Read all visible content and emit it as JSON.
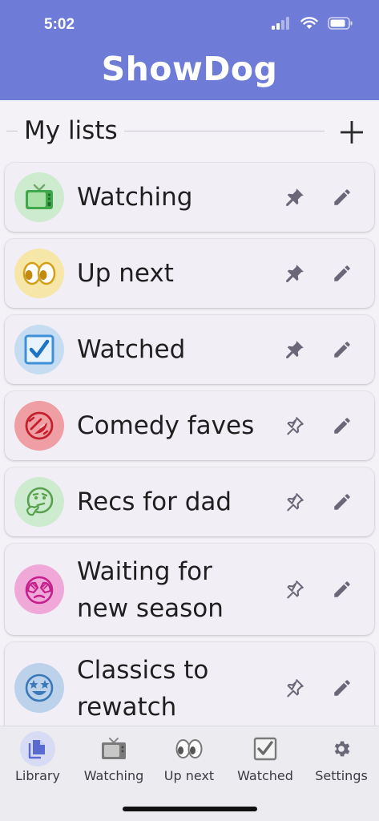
{
  "status_bar": {
    "time": "5:02"
  },
  "app": {
    "title": "ShowDog"
  },
  "section": {
    "title": "My lists",
    "add_glyph": "+"
  },
  "lists": [
    {
      "label": "Watching",
      "icon": "television-icon",
      "color": "#cdeccf",
      "pinned": true
    },
    {
      "label": "Up next",
      "icon": "eyes-icon",
      "color": "#f6e7a8",
      "pinned": true
    },
    {
      "label": "Watched",
      "icon": "checkbox-icon",
      "color": "#c6ddf1",
      "pinned": true
    },
    {
      "label": "Comedy faves",
      "icon": "rolling-laughing-icon",
      "color": "#ef9ea3",
      "pinned": false
    },
    {
      "label": "Recs for dad",
      "icon": "thinking-face-icon",
      "color": "#cdeccf",
      "pinned": false
    },
    {
      "label": "Waiting for new season",
      "icon": "see-no-evil-icon",
      "color": "#f0a8d8",
      "pinned": false
    },
    {
      "label": "Classics to rewatch",
      "icon": "star-struck-icon",
      "color": "#bcd2eb",
      "pinned": false
    }
  ],
  "tabs": [
    {
      "label": "Library",
      "icon": "library-icon",
      "active": true
    },
    {
      "label": "Watching",
      "icon": "television-icon",
      "active": false
    },
    {
      "label": "Up next",
      "icon": "eyes-icon",
      "active": false
    },
    {
      "label": "Watched",
      "icon": "checkbox-icon",
      "active": false
    },
    {
      "label": "Settings",
      "icon": "gear-icon",
      "active": false
    }
  ],
  "colors": {
    "header": "#6e7cd8",
    "background": "#f4f2f7",
    "card": "#f1eef6",
    "action_icon": "#6a6878",
    "active_tab_bg": "#d7dcf4",
    "active_tab_icon": "#5a6bd0"
  }
}
